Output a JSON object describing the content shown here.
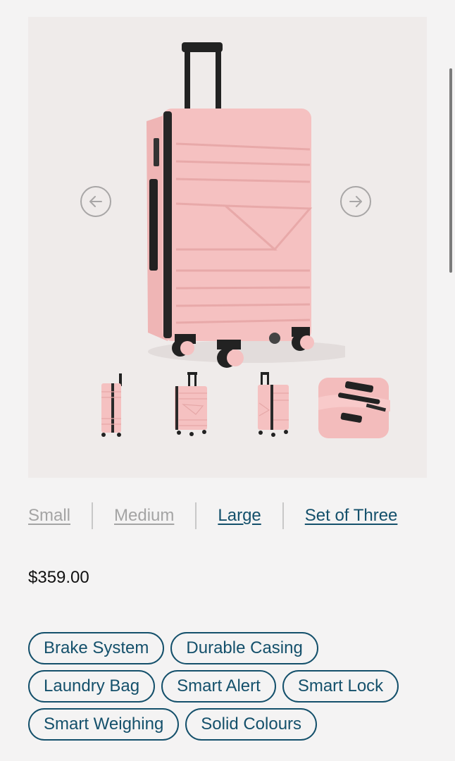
{
  "gallery": {
    "prev_icon": "arrow-left-icon",
    "next_icon": "arrow-right-icon",
    "product_color": "#f5c1c1",
    "trim_color": "#222222"
  },
  "size_options": [
    {
      "label": "Small",
      "active": false
    },
    {
      "label": "Medium",
      "active": false
    },
    {
      "label": "Large",
      "active": true
    },
    {
      "label": "Set of Three",
      "active": true
    }
  ],
  "price": "$359.00",
  "features": {
    "row1": [
      "Brake System",
      "Durable Casing"
    ],
    "row2": [
      "Laundry Bag",
      "Smart Alert",
      "Smart Lock"
    ],
    "row3": [
      "Smart Weighing",
      "Solid Colours"
    ]
  },
  "colors": {
    "accent": "#14506b",
    "inactive_link": "#a4a4a4",
    "gallery_bg": "#efebea"
  }
}
